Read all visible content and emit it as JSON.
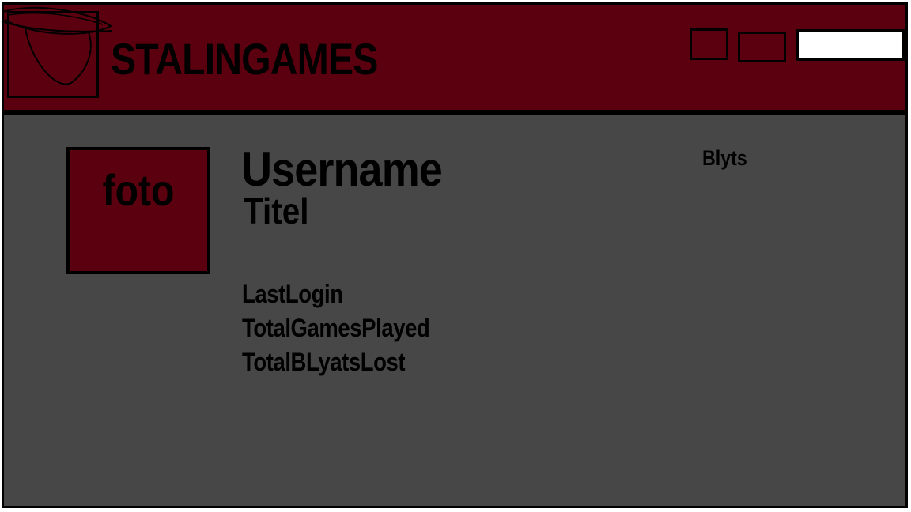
{
  "header": {
    "brand": "STALINGAMES",
    "logo_icon": "hand-drawn-logo-icon",
    "search": {
      "value": "",
      "placeholder": ""
    }
  },
  "profile": {
    "photo_label": "foto",
    "username": "Username",
    "title": "Titel",
    "stats": {
      "last_login": "LastLogin",
      "total_games_played": "TotalGamesPlayed",
      "total_blyats_lost": "TotalBLyatsLost"
    },
    "blyts_label": "Blyts"
  },
  "colors": {
    "header_bg": "#5a000e",
    "content_bg": "#474747",
    "photo_bg": "#5a000e",
    "border": "#000000"
  }
}
